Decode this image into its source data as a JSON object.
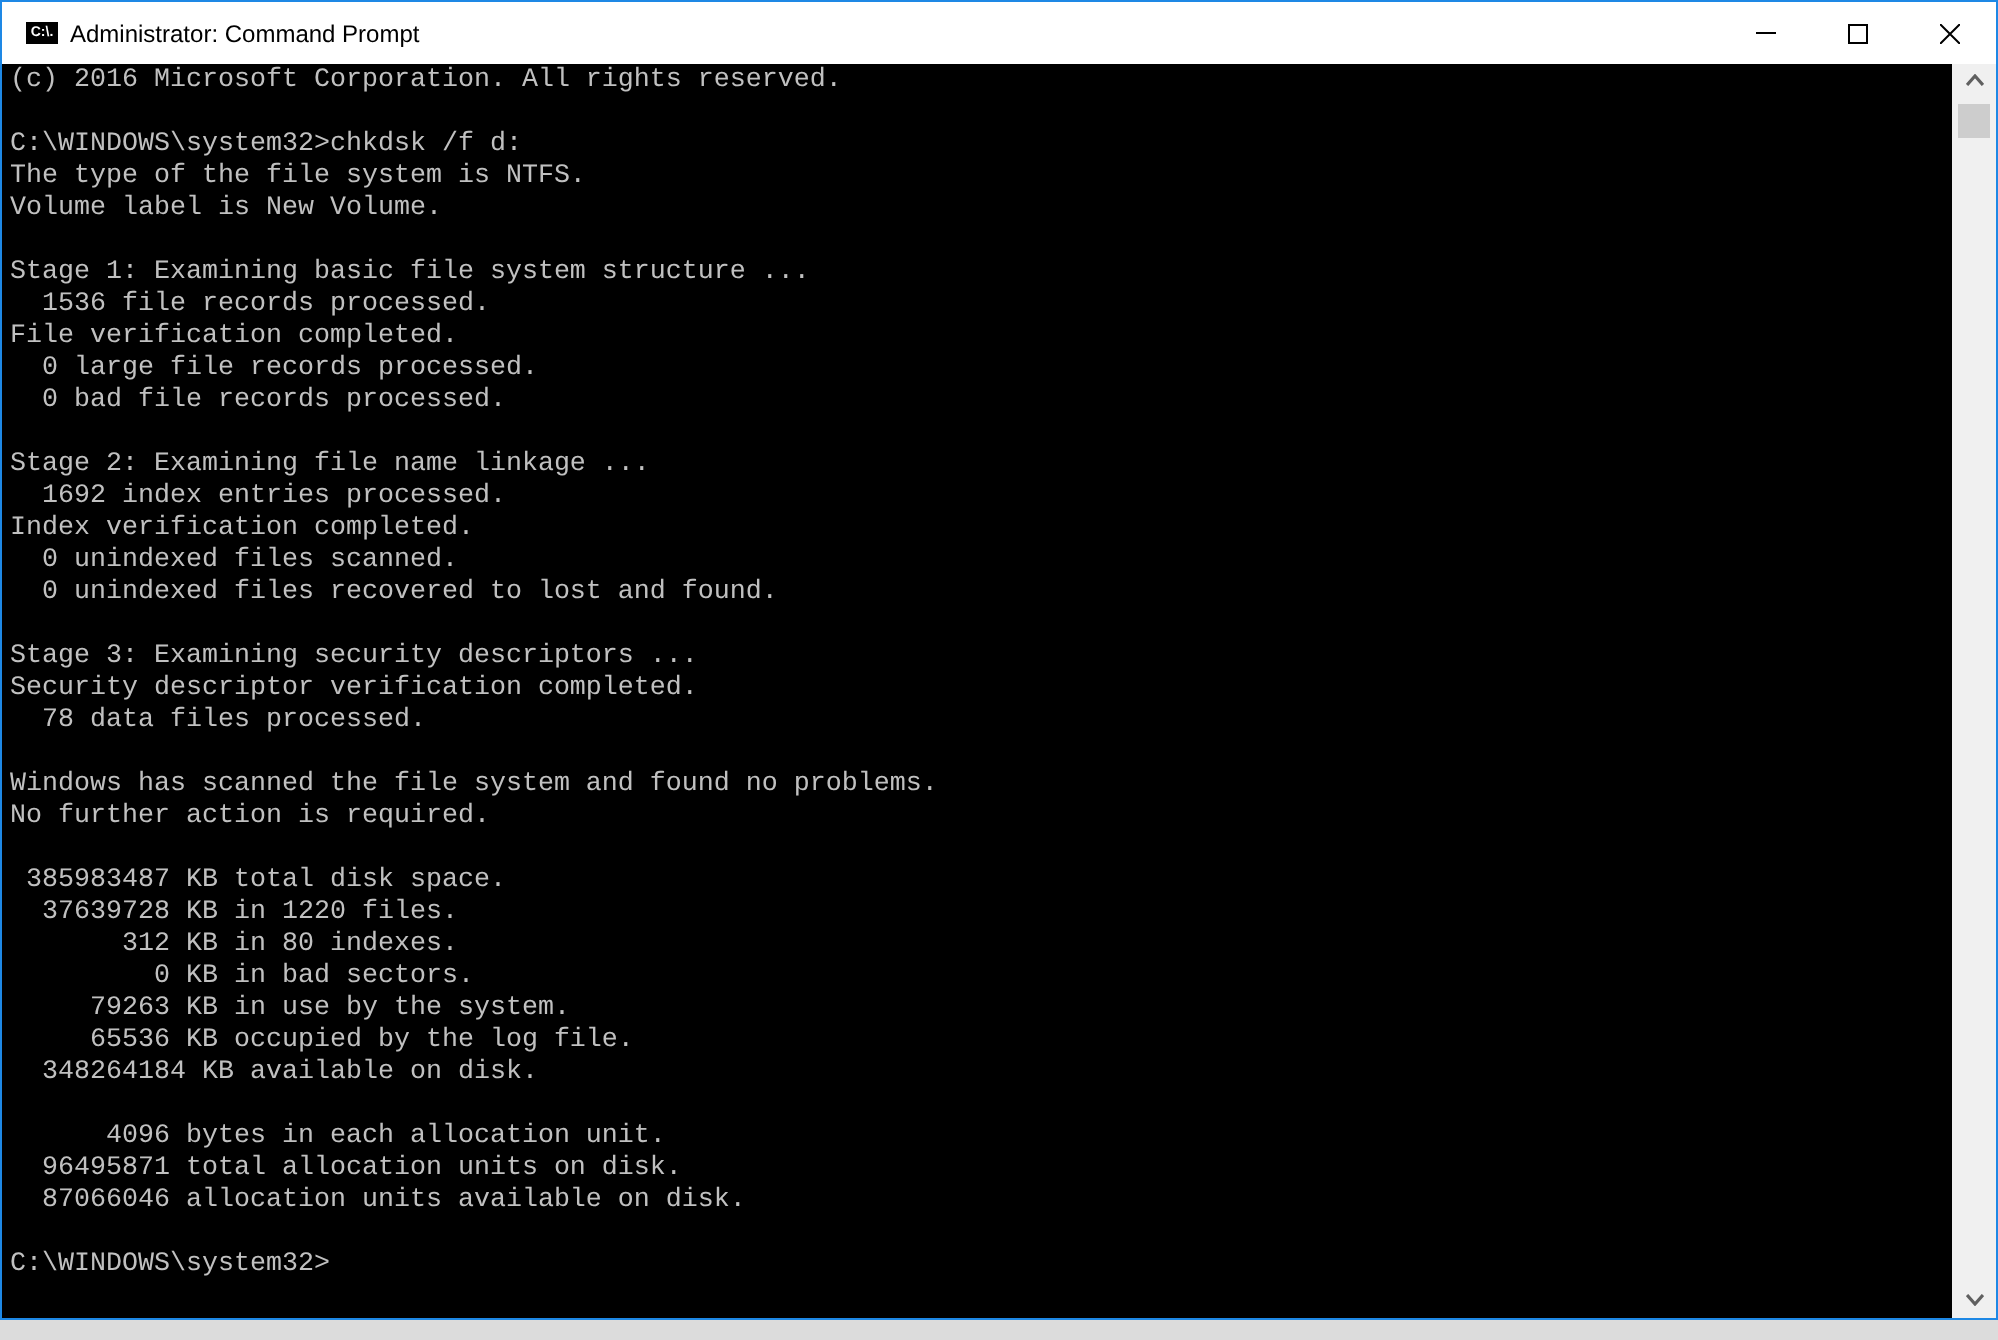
{
  "window": {
    "title": "Administrator: Command Prompt",
    "icon_text": "C:\\."
  },
  "console": {
    "blocks": [
      [
        "(c) 2016 Microsoft Corporation. All rights reserved."
      ],
      [
        "C:\\WINDOWS\\system32>chkdsk /f d:",
        "The type of the file system is NTFS.",
        "Volume label is New Volume."
      ],
      [
        "Stage 1: Examining basic file system structure ...",
        "  1536 file records processed.",
        "File verification completed.",
        "  0 large file records processed.",
        "  0 bad file records processed."
      ],
      [
        "Stage 2: Examining file name linkage ...",
        "  1692 index entries processed.",
        "Index verification completed.",
        "  0 unindexed files scanned.",
        "  0 unindexed files recovered to lost and found."
      ],
      [
        "Stage 3: Examining security descriptors ...",
        "Security descriptor verification completed.",
        "  78 data files processed."
      ],
      [
        "Windows has scanned the file system and found no problems.",
        "No further action is required."
      ],
      [
        " 385983487 KB total disk space.",
        "  37639728 KB in 1220 files.",
        "       312 KB in 80 indexes.",
        "         0 KB in bad sectors.",
        "     79263 KB in use by the system.",
        "     65536 KB occupied by the log file.",
        "  348264184 KB available on disk."
      ],
      [
        "      4096 bytes in each allocation unit.",
        "  96495871 total allocation units on disk.",
        "  87066046 allocation units available on disk."
      ],
      [
        "C:\\WINDOWS\\system32>"
      ]
    ]
  }
}
